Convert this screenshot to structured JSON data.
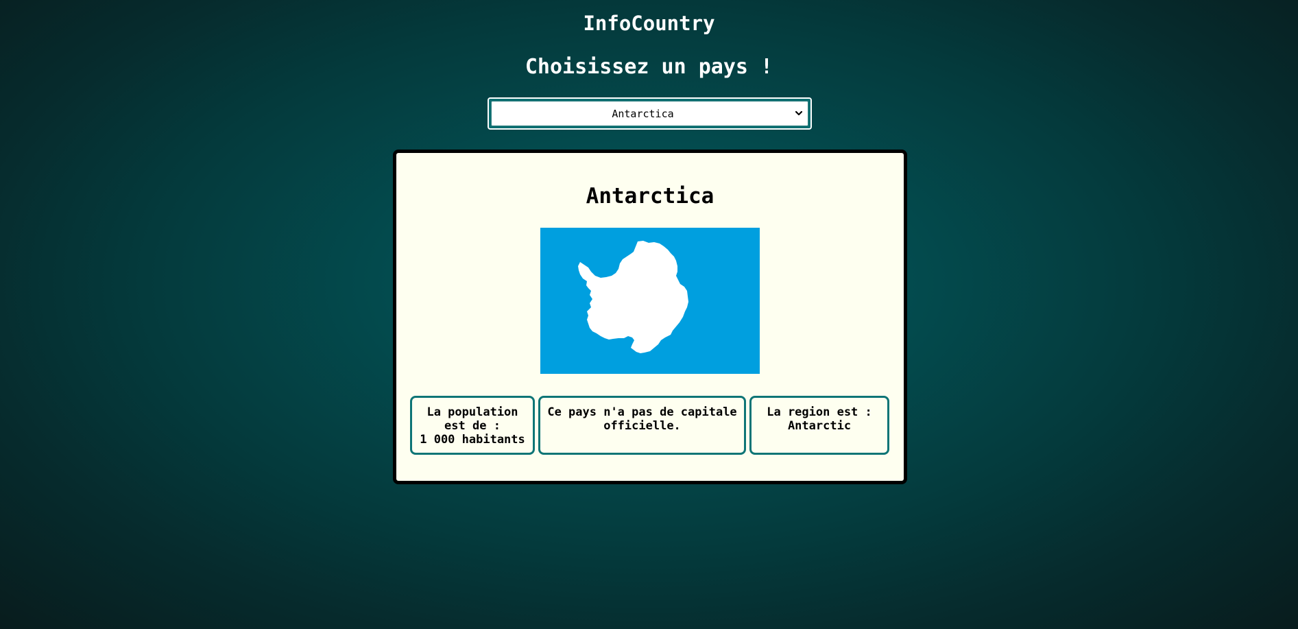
{
  "header": {
    "title": "InfoCountry",
    "subtitle": "Choisissez un pays !"
  },
  "country_select": {
    "selected_value": "Antarctica",
    "chevron_icon": "chevron-down-icon"
  },
  "country_card": {
    "name": "Antarctica",
    "flag": {
      "icon": "antarctica-flag",
      "background_color": "#009fdf",
      "shape_color": "#ffffff"
    },
    "population": {
      "line1": "La population",
      "line2": "est de :",
      "line3": "1 000 habitants"
    },
    "capital": {
      "text": "Ce pays n'a pas de capitale officielle."
    },
    "region": {
      "line1": "La region est :",
      "line2": "Antarctic"
    }
  },
  "colors": {
    "background_center": "#015c5f",
    "background_edge": "#081c1d",
    "card_background": "#fefff0",
    "card_border": "#000000",
    "info_box_border": "#0e7576",
    "header_text": "#ffffff"
  }
}
